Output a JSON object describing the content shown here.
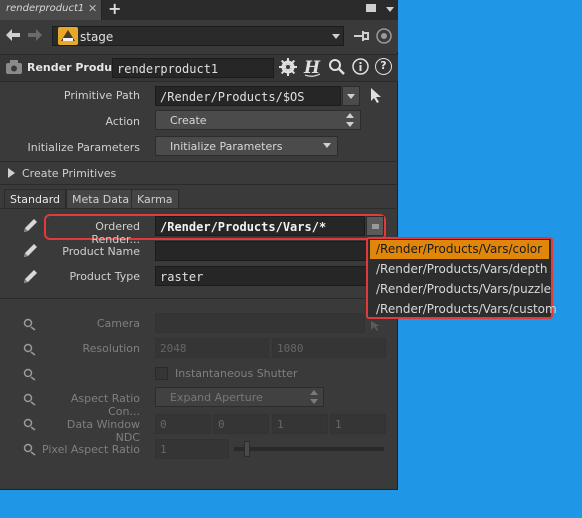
{
  "tab": {
    "label": "renderproduct1",
    "close": "✕",
    "add": "+"
  },
  "pathbar": {
    "context": "stage"
  },
  "header": {
    "node_type": "Render Product",
    "node_name": "renderproduct1",
    "help_icon": "?"
  },
  "params": {
    "primitive_path": {
      "label": "Primitive Path",
      "value": "/Render/Products/$OS"
    },
    "action": {
      "label": "Action",
      "value": "Create"
    },
    "initialize": {
      "label": "Initialize Parameters",
      "value": "Initialize Parameters"
    },
    "create_primitives": "Create Primitives"
  },
  "param_tabs": [
    "Standard",
    "Meta Data",
    "Karma"
  ],
  "standard": {
    "ordered_render": {
      "label": "Ordered Render...",
      "value": "/Render/Products/Vars/*"
    },
    "product_name": {
      "label": "Product Name",
      "value": ""
    },
    "product_type": {
      "label": "Product Type",
      "value": "raster"
    },
    "camera": {
      "label": "Camera",
      "value": ""
    },
    "resolution": {
      "label": "Resolution",
      "values": [
        "2048",
        "1080"
      ]
    },
    "instantaneous_shutter": {
      "label": "Instantaneous Shutter"
    },
    "aspect_ratio": {
      "label": "Aspect Ratio Con...",
      "value": "Expand Aperture"
    },
    "data_window": {
      "label": "Data Window NDC",
      "values": [
        "0",
        "0",
        "1",
        "1"
      ]
    },
    "pixel_aspect": {
      "label": "Pixel Aspect Ratio",
      "value": "1"
    }
  },
  "dropdown": {
    "items": [
      "/Render/Products/Vars/color",
      "/Render/Products/Vars/depth",
      "/Render/Products/Vars/puzzle",
      "/Render/Products/Vars/custom"
    ],
    "selected_index": 0
  },
  "colors": {
    "accent_orange": "#e0870b",
    "highlight_red": "#e03a3a",
    "desktop_blue": "#1f97e6"
  }
}
